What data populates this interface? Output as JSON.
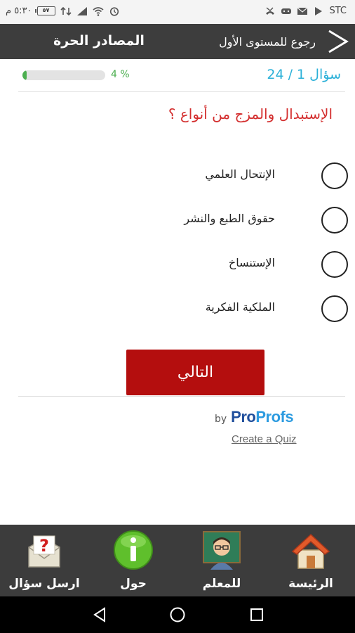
{
  "status_bar": {
    "time": "٥:٣٠ م",
    "battery": "٥٧",
    "carrier": "STC"
  },
  "header": {
    "title": "المصادر الحرة",
    "back_label": "رجوع للمستوى الأول"
  },
  "progress": {
    "percent_label": "4 %",
    "value": 0.04,
    "question_count": "سؤال 1 / 24"
  },
  "question": {
    "text": "الإستبدال والمزج من أنواع ؟",
    "options": [
      "الإنتحال العلمي",
      "حقوق الطبع والنشر",
      "الإستنساخ",
      "الملكية الفكرية"
    ]
  },
  "next_label": "التالي",
  "branding": {
    "by": "by",
    "pro": "Pro",
    "profs": "Profs",
    "create_quiz": "Create a Quiz"
  },
  "bottom_nav": {
    "items": [
      {
        "label": "ارسل سؤال",
        "icon": "send-question-icon"
      },
      {
        "label": "حول",
        "icon": "info-icon"
      },
      {
        "label": "للمعلم",
        "icon": "teacher-icon"
      },
      {
        "label": "الرئيسة",
        "icon": "home-icon"
      }
    ]
  },
  "colors": {
    "accent_red": "#b40e0e",
    "question_red": "#d32d2d",
    "progress_green": "#4caf50",
    "count_blue": "#2ab0d8",
    "header_dark": "#3d3d3d"
  }
}
